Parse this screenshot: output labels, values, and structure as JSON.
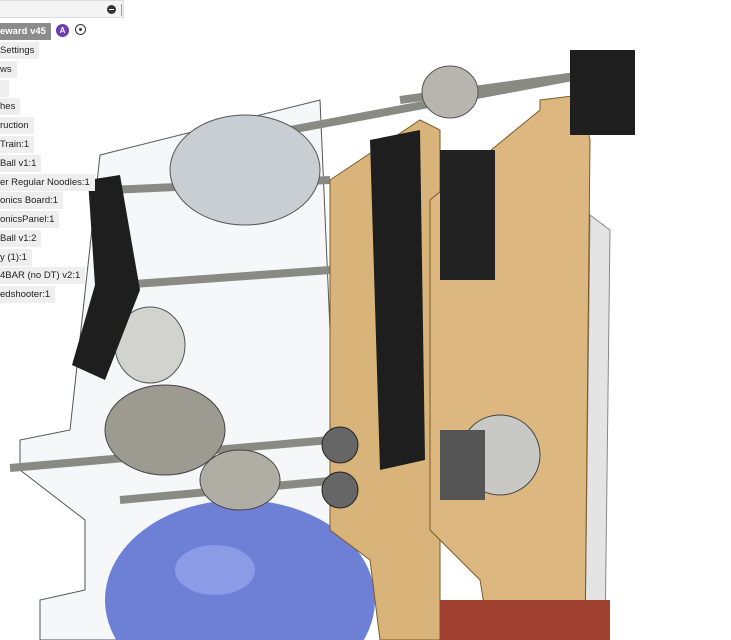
{
  "browser": {
    "root": "eward v45",
    "root_badge": "A",
    "items": [
      "Settings",
      "ws",
      "",
      "hes",
      "ruction",
      "Train:1",
      "Ball v1:1",
      "er Regular Noodles:1",
      "onics Board:1",
      "onicsPanel:1",
      "Ball v1:2",
      "y (1):1",
      "4BAR (no DT) v2:1",
      "edshooter:1"
    ]
  },
  "colors": {
    "wood": "#d9b47a",
    "ball": "#6e7fd6",
    "belt": "#1e1e1e",
    "metal": "#a8a8a0"
  }
}
